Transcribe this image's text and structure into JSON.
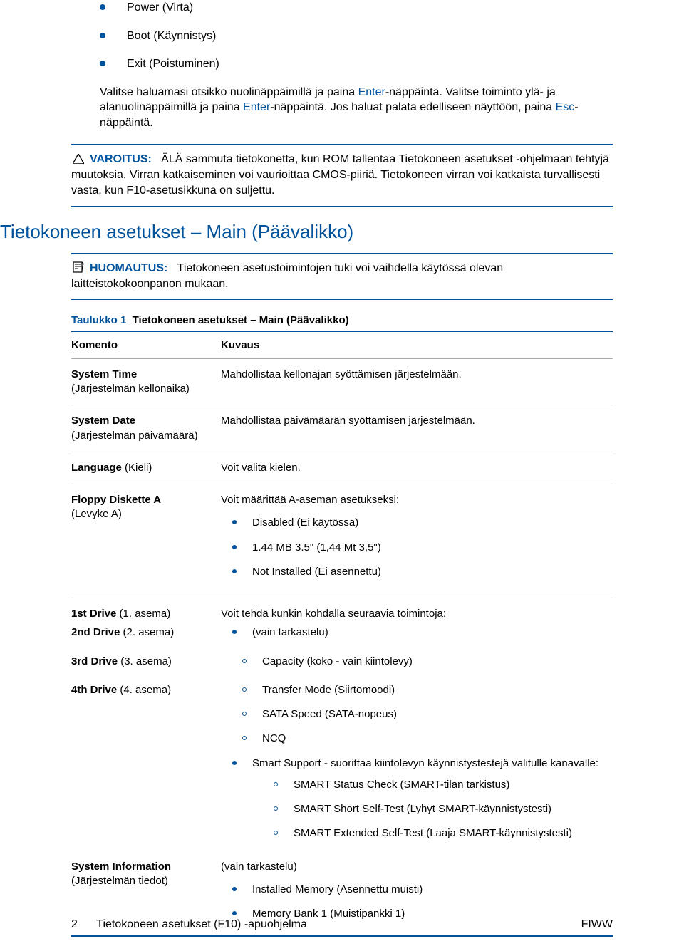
{
  "intro_bullets": [
    "Power (Virta)",
    "Boot (Käynnistys)",
    "Exit (Poistuminen)"
  ],
  "intro_para_parts": {
    "pre1": "Valitse haluamasi otsikko nuolinäppäimillä ja paina ",
    "enter1": "Enter",
    "mid1": "-näppäintä. Valitse toiminto ylä- ja alanuolinäppäimillä ja paina ",
    "enter2": "Enter",
    "mid2": "-näppäintä. Jos haluat palata edelliseen näyttöön, paina ",
    "esc": "Esc",
    "post": "-näppäintä."
  },
  "warning": {
    "label": "VAROITUS:",
    "text": "ÄLÄ sammuta tietokonetta, kun ROM tallentaa Tietokoneen asetukset -ohjelmaan tehtyjä muutoksia. Virran katkaiseminen voi vaurioittaa CMOS-piiriä. Tietokoneen virran voi katkaista turvallisesti vasta, kun F10-asetusikkuna on suljettu."
  },
  "h2": "Tietokoneen asetukset – Main (Päävalikko)",
  "note": {
    "label": "HUOMAUTUS:",
    "text": "Tietokoneen asetustoimintojen tuki voi vaihdella käytössä olevan laitteistokokoonpanon mukaan."
  },
  "table_title_prefix": "Taulukko 1",
  "table_title_caption": "Tietokoneen asetukset – Main (Päävalikko)",
  "columns": {
    "cmd": "Komento",
    "desc": "Kuvaus"
  },
  "rows": {
    "system_time": {
      "cmd": "System Time",
      "sub": "(Järjestelmän kellonaika)",
      "desc": "Mahdollistaa kellonajan syöttämisen järjestelmään."
    },
    "system_date": {
      "cmd": "System Date",
      "sub": "(Järjestelmän päivämäärä)",
      "desc": "Mahdollistaa päivämäärän syöttämisen järjestelmään."
    },
    "language": {
      "cmd": "Language",
      "sub": "(Kieli)",
      "desc": "Voit valita kielen."
    },
    "floppy": {
      "cmd": "Floppy Diskette A",
      "sub": "(Levyke A)",
      "desc_intro": "Voit määrittää A-aseman asetukseksi:",
      "opts": [
        "Disabled (Ei käytössä)",
        "1.44 MB 3.5\" (1,44 Mt 3,5\")",
        "Not Installed (Ei asennettu)"
      ]
    },
    "drives": {
      "d1_cmd": "1st Drive",
      "d1_sub": "(1. asema)",
      "d2_cmd": "2nd Drive",
      "d2_sub": "(2. asema)",
      "d3_cmd": "3rd Drive",
      "d3_sub": "(3. asema)",
      "d4_cmd": "4th Drive",
      "d4_sub": "(4. asema)",
      "desc_intro": "Voit tehdä kunkin kohdalla seuraavia toimintoja:",
      "view_only": "(vain tarkastelu)",
      "sub_opts": [
        "Capacity (koko - vain kiintolevy)",
        "Transfer Mode (Siirtomoodi)",
        "SATA Speed (SATA-nopeus)",
        "NCQ"
      ],
      "smart_intro": "Smart Support - suorittaa kiintolevyn käynnistystestejä valitulle kanavalle:",
      "smart_opts": [
        "SMART Status Check (SMART-tilan tarkistus)",
        "SMART Short Self-Test (Lyhyt SMART-käynnistystesti)",
        "SMART Extended Self-Test (Laaja SMART-käynnistystesti)"
      ]
    },
    "sysinfo": {
      "cmd": "System Information",
      "sub": "(Järjestelmän tiedot)",
      "view_only": "(vain tarkastelu)",
      "opts": [
        "Installed Memory (Asennettu muisti)",
        "Memory Bank 1 (Muistipankki 1)"
      ]
    }
  },
  "footer": {
    "left_num": "2",
    "left_text": "Tietokoneen asetukset (F10) -apuohjelma",
    "right": "FIWW"
  }
}
